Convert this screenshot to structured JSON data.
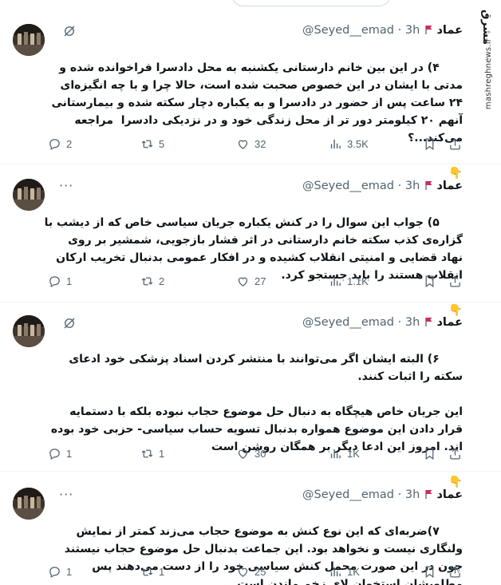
{
  "watermark": {
    "logo": "مشرق",
    "url": "mashreghnews.ir"
  },
  "tweets": [
    {
      "display_name": "عماد",
      "handle": "@Seyed__emad",
      "time": "3h",
      "text": "۴) در این بین خانم دارستانی یکشنبه به محل دادسرا فراخوانده شده و مدتی با ایشان در این خصوص صحبت شده است، حالا چرا و با چه انگیزه‌ای ۲۴ ساعت پس از حضور در دادسرا و به یکباره دچار سکته شده و بیمارستانی آنهم ۲۰ کیلومتر دور تر از محل زندگی خود و در نزدیکی دادسرا  مراجعه می‌کند...؟",
      "emoji": "👇",
      "replies": "2",
      "reposts": "5",
      "likes": "32",
      "views": "3.5K"
    },
    {
      "display_name": "عماد",
      "handle": "@Seyed__emad",
      "time": "3h",
      "text": "۵) جواب این سوال را در کنش یکباره جریان سیاسی خاص که از دیشب با گزاره‌ی کذب سکته خانم دارستانی در اثر فشار بازجویی، شمشیر بر روی نهاد قضایی و امنیتی انقلاب کشیده و در افکار عمومی بدنبال تخریب ارکان انقلاب هستند را باید جستجو کرد.",
      "emoji": "👇",
      "replies": "1",
      "reposts": "2",
      "likes": "27",
      "views": "1.1K"
    },
    {
      "display_name": "عماد",
      "handle": "@Seyed__emad",
      "time": "3h",
      "text": "۶) البته ایشان اگر می‌توانند با منتشر کردن اسناد پزشکی خود ادعای سکته را اثبات کنند.\n\nاین جریان خاص هیچگاه به دنبال حل موضوع حجاب نبوده بلکه با دستمایه قرار دادن این موضوع همواره بدنبال تسویه حساب سیاسی- حزبی خود بوده اند. امروز این ادعا دیگر بر همگان روشن است",
      "emoji": "👇",
      "replies": "1",
      "reposts": "1",
      "likes": "30",
      "views": "1K"
    },
    {
      "display_name": "عماد",
      "handle": "@Seyed__emad",
      "time": "3h",
      "text": "۷)ضربه‌ای که این نوع کنش به موضوع حجاب می‌زند کمتر از نمایش ولنگاری نیست و نخواهد بود. این جماعت بدنبال حل موضوع حجاب نیستند چون در این صورت محمل کنش سیاسی خود را از دست می‌دهند پس مطلوبشان استخوان لای زخم ماندن است...",
      "emoji": "",
      "replies": "1",
      "reposts": "1",
      "likes": "25",
      "views": "1K"
    }
  ]
}
